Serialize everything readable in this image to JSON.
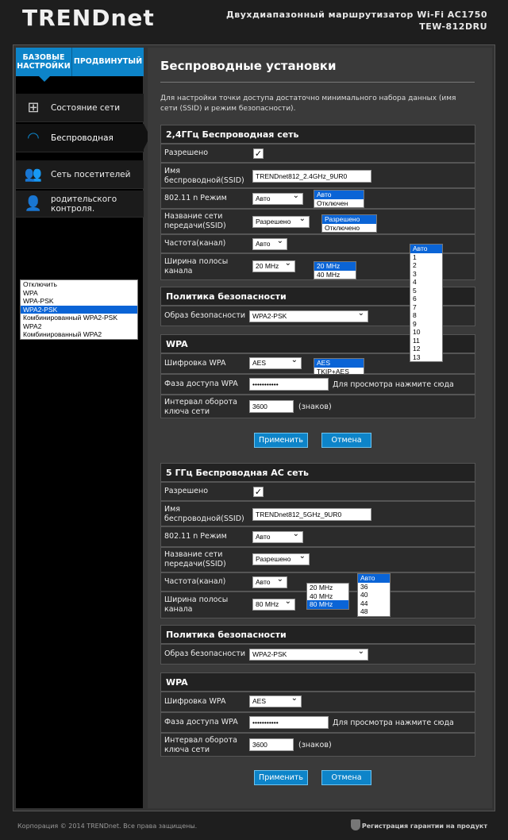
{
  "header": {
    "logo": "TRENDnet",
    "product_line1": "Двухдиапазонный маршрутизатор Wi-Fi AC1750",
    "product_line2": "TEW-812DRU"
  },
  "tabs": {
    "basic": "БАЗОВЫЕ НАСТРОЙКИ",
    "advanced": "ПРОДВИНУТЫЙ"
  },
  "menu": [
    {
      "label": "Состояние сети",
      "icon": "network-status-icon"
    },
    {
      "label": "Беспроводная",
      "icon": "wifi-icon"
    },
    {
      "label": "Сеть посетителей",
      "icon": "guest-users-icon"
    },
    {
      "label": "родительского контроля.",
      "icon": "parental-control-icon"
    }
  ],
  "page": {
    "title": "Беспроводные установки",
    "description": "Для настройки точки доступа достаточно минимального набора данных (имя сети (SSID) и режим безопасности)."
  },
  "w24": {
    "header": "2,4ГГц Беспроводная сеть",
    "enabled_label": "Разрешено",
    "ssid_label": "Имя беспроводной(SSID)",
    "ssid_value": "TRENDnet812_2.4GHz_9UR0",
    "mode_label": "802.11 n Режим",
    "mode_value": "Авто",
    "mode_options": [
      "Авто",
      "Отключен"
    ],
    "broadcast_label": "Название сети передачи(SSID)",
    "broadcast_value": "Разрешено",
    "broadcast_options": [
      "Разрешено",
      "Отключено"
    ],
    "channel_label": "Частота(канал)",
    "channel_value": "Авто",
    "channel_options": [
      "Авто",
      "1",
      "2",
      "3",
      "4",
      "5",
      "6",
      "7",
      "8",
      "9",
      "10",
      "11",
      "12",
      "13"
    ],
    "bandwidth_label": "Ширина полосы канала",
    "bandwidth_value": "20 MHz",
    "bandwidth_options": [
      "20 MHz",
      "40 MHz"
    ]
  },
  "sec24": {
    "header": "Политика безопасности",
    "profile_label": "Образ безопасности",
    "profile_value": "WPA2-PSK",
    "profile_options": [
      "Отключить",
      "WPA",
      "WPA-PSK",
      "WPA2-PSK",
      "Комбинированный WPA2-PSK",
      "WPA2",
      "Комбинированный WPA2"
    ]
  },
  "wpa24": {
    "header": "WPA",
    "cipher_label": "Шифровка WPA",
    "cipher_value": "AES",
    "cipher_options": [
      "AES",
      "TKIP+AES"
    ],
    "pass_label": "Фаза доступа WPA",
    "pass_value": "•••••••••••",
    "pass_hint": "Для просмотра нажмите сюда",
    "interval_label": "Интервал оборота ключа сети",
    "interval_value": "3600",
    "interval_unit": "(знаков)"
  },
  "buttons24": {
    "apply": "Применить",
    "cancel": "Отмена"
  },
  "w5": {
    "header": "5 ГГц Беспроводная AC сеть",
    "enabled_label": "Разрешено",
    "ssid_label": "Имя беспроводной(SSID)",
    "ssid_value": "TRENDnet812_5GHz_9UR0",
    "mode_label": "802.11 n Режим",
    "mode_value": "Авто",
    "broadcast_label": "Название сети передачи(SSID)",
    "broadcast_value": "Разрешено",
    "channel_label": "Частота(канал)",
    "channel_value": "Авто",
    "channel_options": [
      "Авто",
      "36",
      "40",
      "44",
      "48"
    ],
    "bandwidth_label": "Ширина полосы канала",
    "bandwidth_value": "80 MHz",
    "bandwidth_options": [
      "20 MHz",
      "40 MHz",
      "80 MHz"
    ]
  },
  "sec5": {
    "header": "Политика безопасности",
    "profile_label": "Образ безопасности",
    "profile_value": "WPA2-PSK"
  },
  "wpa5": {
    "header": "WPA",
    "cipher_label": "Шифровка WPA",
    "cipher_value": "AES",
    "pass_label": "Фаза доступа WPA",
    "pass_value": "•••••••••••",
    "pass_hint": "Для просмотра нажмите сюда",
    "interval_label": "Интервал оборота ключа сети",
    "interval_value": "3600",
    "interval_unit": "(знаков)"
  },
  "buttons5": {
    "apply": "Применить",
    "cancel": "Отмена"
  },
  "footer": {
    "copyright": "Корпорация © 2014 TRENDnet. Все права защищены.",
    "warranty": "Регистрация гарантии на продукт"
  }
}
